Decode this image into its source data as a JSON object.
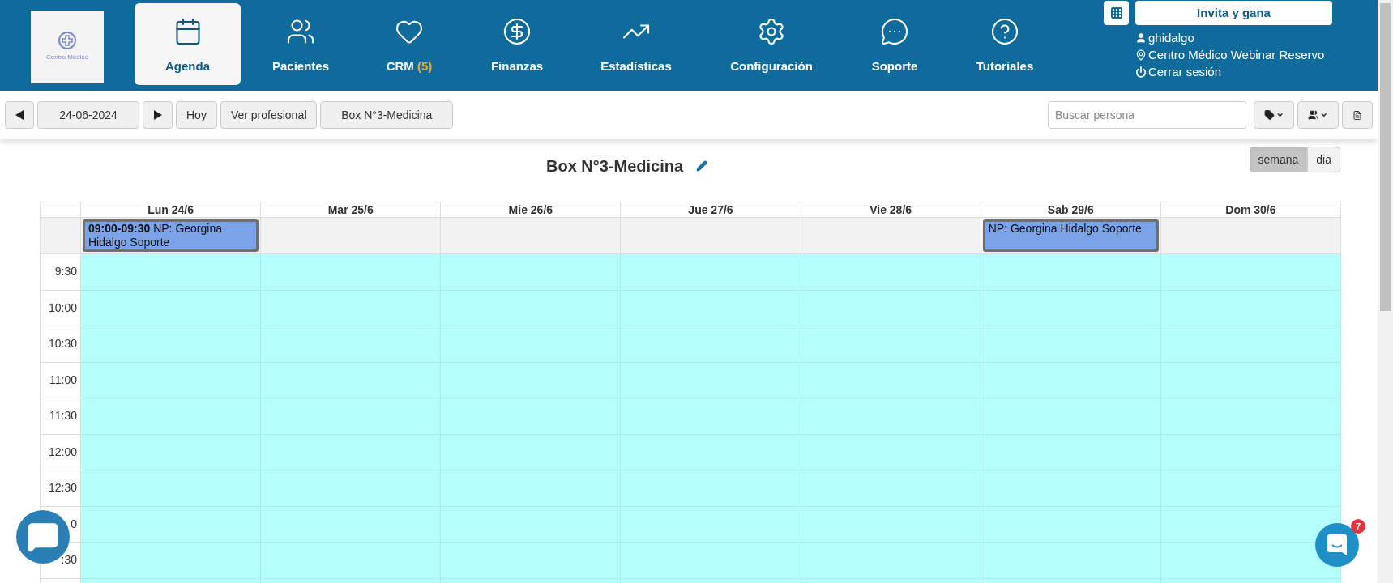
{
  "header": {
    "logo": {
      "text": "Centro Médico"
    },
    "nav": [
      {
        "label": "Agenda",
        "selected": true
      },
      {
        "label": "Pacientes",
        "selected": false
      },
      {
        "label": "CRM",
        "badge": "(5)",
        "selected": false
      },
      {
        "label": "Finanzas",
        "selected": false
      },
      {
        "label": "Estadísticas",
        "selected": false
      },
      {
        "label": "Configuración",
        "selected": false
      },
      {
        "label": "Soporte",
        "selected": false
      },
      {
        "label": "Tutoriales",
        "selected": false
      }
    ],
    "invite_button": "Invita y gana",
    "account": {
      "username": "ghidalgo",
      "location": "Centro Médico Webinar Reservo",
      "logout": "Cerrar sesión"
    }
  },
  "toolbar": {
    "date": "24-06-2024",
    "today": "Hoy",
    "professional_button": "Ver profesional",
    "box_button": "Box N°3-Medicina",
    "search": {
      "placeholder": "Buscar persona"
    }
  },
  "calendar": {
    "title": "Box N°3-Medicina",
    "views": [
      {
        "label": "semana",
        "selected": true
      },
      {
        "label": "dia",
        "selected": false
      }
    ],
    "days": [
      {
        "label": "Lun 24/6",
        "events": [
          {
            "text": "**09:00-09:30** NP: Georgina Hidalgo Soporte"
          }
        ]
      },
      {
        "label": "Mar 25/6"
      },
      {
        "label": "Mie 26/6"
      },
      {
        "label": "Jue 27/6"
      },
      {
        "label": "Vie 28/6"
      },
      {
        "label": "Sab 29/6",
        "events": [
          {
            "text": "NP: Georgina Hidalgo Soporte"
          }
        ]
      },
      {
        "label": "Dom 30/6"
      }
    ],
    "times": [
      "9:30",
      "10:00",
      "10:30",
      "11:00",
      "11:30",
      "12:00",
      "12:30",
      "0",
      ":30"
    ]
  },
  "chat_widget": {
    "badge": "7"
  }
}
